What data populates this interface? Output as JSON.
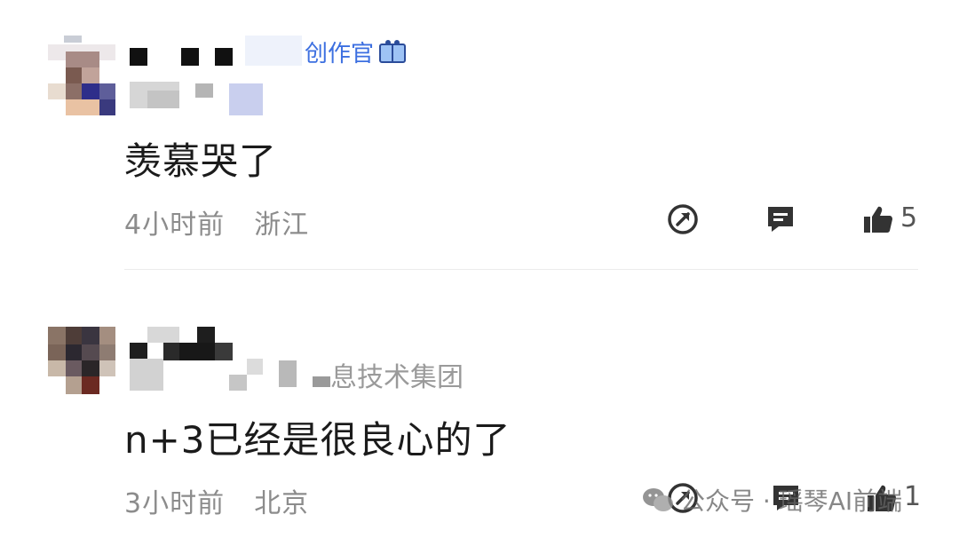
{
  "comments": [
    {
      "badge": "创作官",
      "text": "羡慕哭了",
      "time": "4小时前",
      "location": "浙江",
      "like_count": "5"
    },
    {
      "org": "息技术集团",
      "text": "n+3已经是很良心的了",
      "time": "3小时前",
      "location": "北京",
      "like_count": "1"
    }
  ],
  "watermark": {
    "label": "公众号 · 瑶琴AI前端"
  },
  "icons": {
    "share": "share-icon",
    "reply": "comment-icon",
    "like": "thumbs-up-icon",
    "badge": "book-icon",
    "watermark": "wechat-icon"
  }
}
